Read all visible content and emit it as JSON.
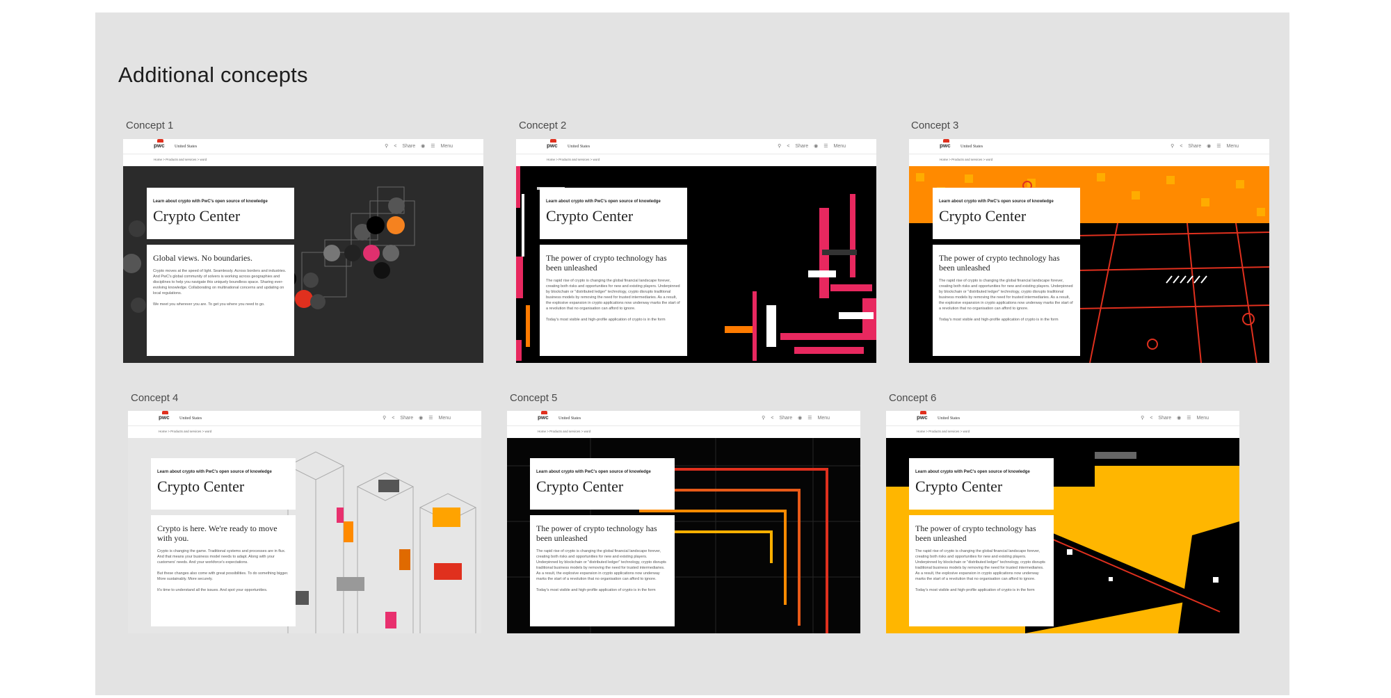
{
  "board": {
    "title": "Additional concepts"
  },
  "common": {
    "territory": "United States",
    "share": "Share",
    "menu": "Menu",
    "breadcrumb": "Home  >  Products and services  >  word",
    "kicker": "Learn about crypto with PwC's open source of knowledge",
    "page_title": "Crypto Center",
    "logo": "pwc"
  },
  "concepts": [
    {
      "label": "Concept 1",
      "subhead": "Global views. No boundaries.",
      "para1": "Crypto moves at the speed of light. Seamlessly. Across borders and industries. And PwC's global community of solvers is working across geographies and disciplines to help you navigate this uniquely boundless space. Sharing ever-evolving knowledge. Collaborating on multinational concerns and updating on local regulations.",
      "para2": "We meet you wherever you are. To get you where you need to go.",
      "accent": "#2b2b2b"
    },
    {
      "label": "Concept 2",
      "subhead": "The power of crypto technology has been unleashed",
      "para1": "The rapid rise of crypto is changing the global financial landscape forever, creating both risks and opportunities for new and existing players. Underpinned by blockchain or \"distributed ledger\" technology, crypto disrupts traditional business models by removing the need for trusted intermediaries. As a result, the explosive expansion in crypto applications now underway marks the start of a revolution that no organisation can afford to ignore.",
      "para2": "Today's most visible and high-profile application of crypto is in the form",
      "accent": "#000000"
    },
    {
      "label": "Concept 3",
      "subhead": "The power of crypto technology has been unleashed",
      "para1": "The rapid rise of crypto is changing the global financial landscape forever, creating both risks and opportunities for new and existing players. Underpinned by blockchain or \"distributed ledger\" technology, crypto disrupts traditional business models by removing the need for trusted intermediaries. As a result, the explosive expansion in crypto applications now underway marks the start of a revolution that no organisation can afford to ignore.",
      "para2": "Today's most visible and high-profile application of crypto is in the form",
      "accent": "#ff8a00"
    },
    {
      "label": "Concept 4",
      "subhead": "Crypto is here. We're ready to move with you.",
      "para1": "Crypto is changing the game. Traditional systems and processes are in flux. And that means your business model needs to adapt. Along with your customers' needs. And your workforce's expectations.",
      "para2": "But these changes also come with great possibilities. To do something bigger. More sustainably. More securely.",
      "para3": "It's time to understand all the issues. And spot your opportunities.",
      "accent": "#e6e6e6"
    },
    {
      "label": "Concept 5",
      "subhead": "The power of crypto technology has been unleashed",
      "para1": "The rapid rise of crypto is changing the global financial landscape forever, creating both risks and opportunities for new and existing players. Underpinned by blockchain or \"distributed ledger\" technology, crypto disrupts traditional business models by removing the need for trusted intermediaries. As a result, the explosive expansion in crypto applications now underway marks the start of a revolution that no organisation can afford to ignore.",
      "para2": "Today's most visible and high-profile application of crypto is in the form",
      "accent": "#050505"
    },
    {
      "label": "Concept 6",
      "subhead": "The power of crypto technology has been unleashed",
      "para1": "The rapid rise of crypto is changing the global financial landscape forever, creating both risks and opportunities for new and existing players. Underpinned by blockchain or \"distributed ledger\" technology, crypto disrupts traditional business models by removing the need for trusted intermediaries. As a result, the explosive expansion in crypto applications now underway marks the start of a revolution that no organisation can afford to ignore.",
      "para2": "Today's most visible and high-profile application of crypto is in the form",
      "accent": "#ffb600"
    }
  ]
}
